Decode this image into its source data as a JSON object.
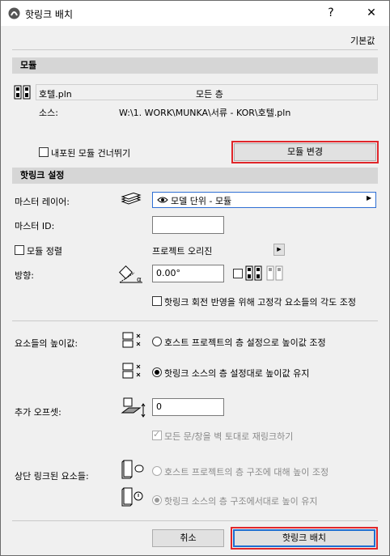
{
  "window": {
    "title": "핫링크 배치",
    "help_label": "?",
    "close_label": "✕",
    "defaults_label": "기본값"
  },
  "module_section": {
    "header": "모듈",
    "file_name": "호텔.pln",
    "stories_value": "모든 층",
    "source_label": "소스:",
    "source_path": "W:\\1. WORK\\MUNKA\\서류 - KOR\\호텔.pln",
    "skip_nested_label": "내포된 모듈 건너뛰기",
    "skip_nested_checked": false,
    "change_module_label": "모듈 변경"
  },
  "hotlink_settings": {
    "header": "핫링크 설정",
    "master_layer_label": "마스터 레이어:",
    "master_layer_value": "모델 단위 - 모듈",
    "master_id_label": "마스터 ID:",
    "master_id_value": "",
    "align_module_label": "모듈 정렬",
    "align_module_checked": false,
    "project_origin_label": "프로젝트 오리진",
    "orientation_label": "방향:",
    "orientation_value": "0.00°",
    "mirror_checked": false,
    "adjust_angle_label": "핫링크 회전 반영을 위해 고정각 요소들의 각도 조정",
    "adjust_angle_checked": false,
    "elevation_label": "요소들의 높이값:",
    "elevation_option_host": "호스트 프로젝트의 층 설정으로 높이값 조정",
    "elevation_option_source": "핫링크 소스의 층 설정대로 높이값 유지",
    "elevation_selected": "source",
    "offset_label": "추가 오프셋:",
    "offset_value": "0",
    "relink_label": "모든 문/창을 벽 토대로 재링크하기",
    "relink_checked": true,
    "top_linked_label": "상단 링크된 요소들:",
    "top_linked_option_host": "호스트 프로젝트의 층 구조에 대해 높이 조정",
    "top_linked_option_source": "핫링크 소스의 층 구조에서대로 높이 유지",
    "top_linked_selected": "source"
  },
  "footer": {
    "cancel_label": "취소",
    "place_label": "핫링크 배치"
  },
  "colors": {
    "highlight_red": "#e0262a",
    "focus_blue": "#1e6fd1",
    "section_gray": "#d6d6d6"
  }
}
